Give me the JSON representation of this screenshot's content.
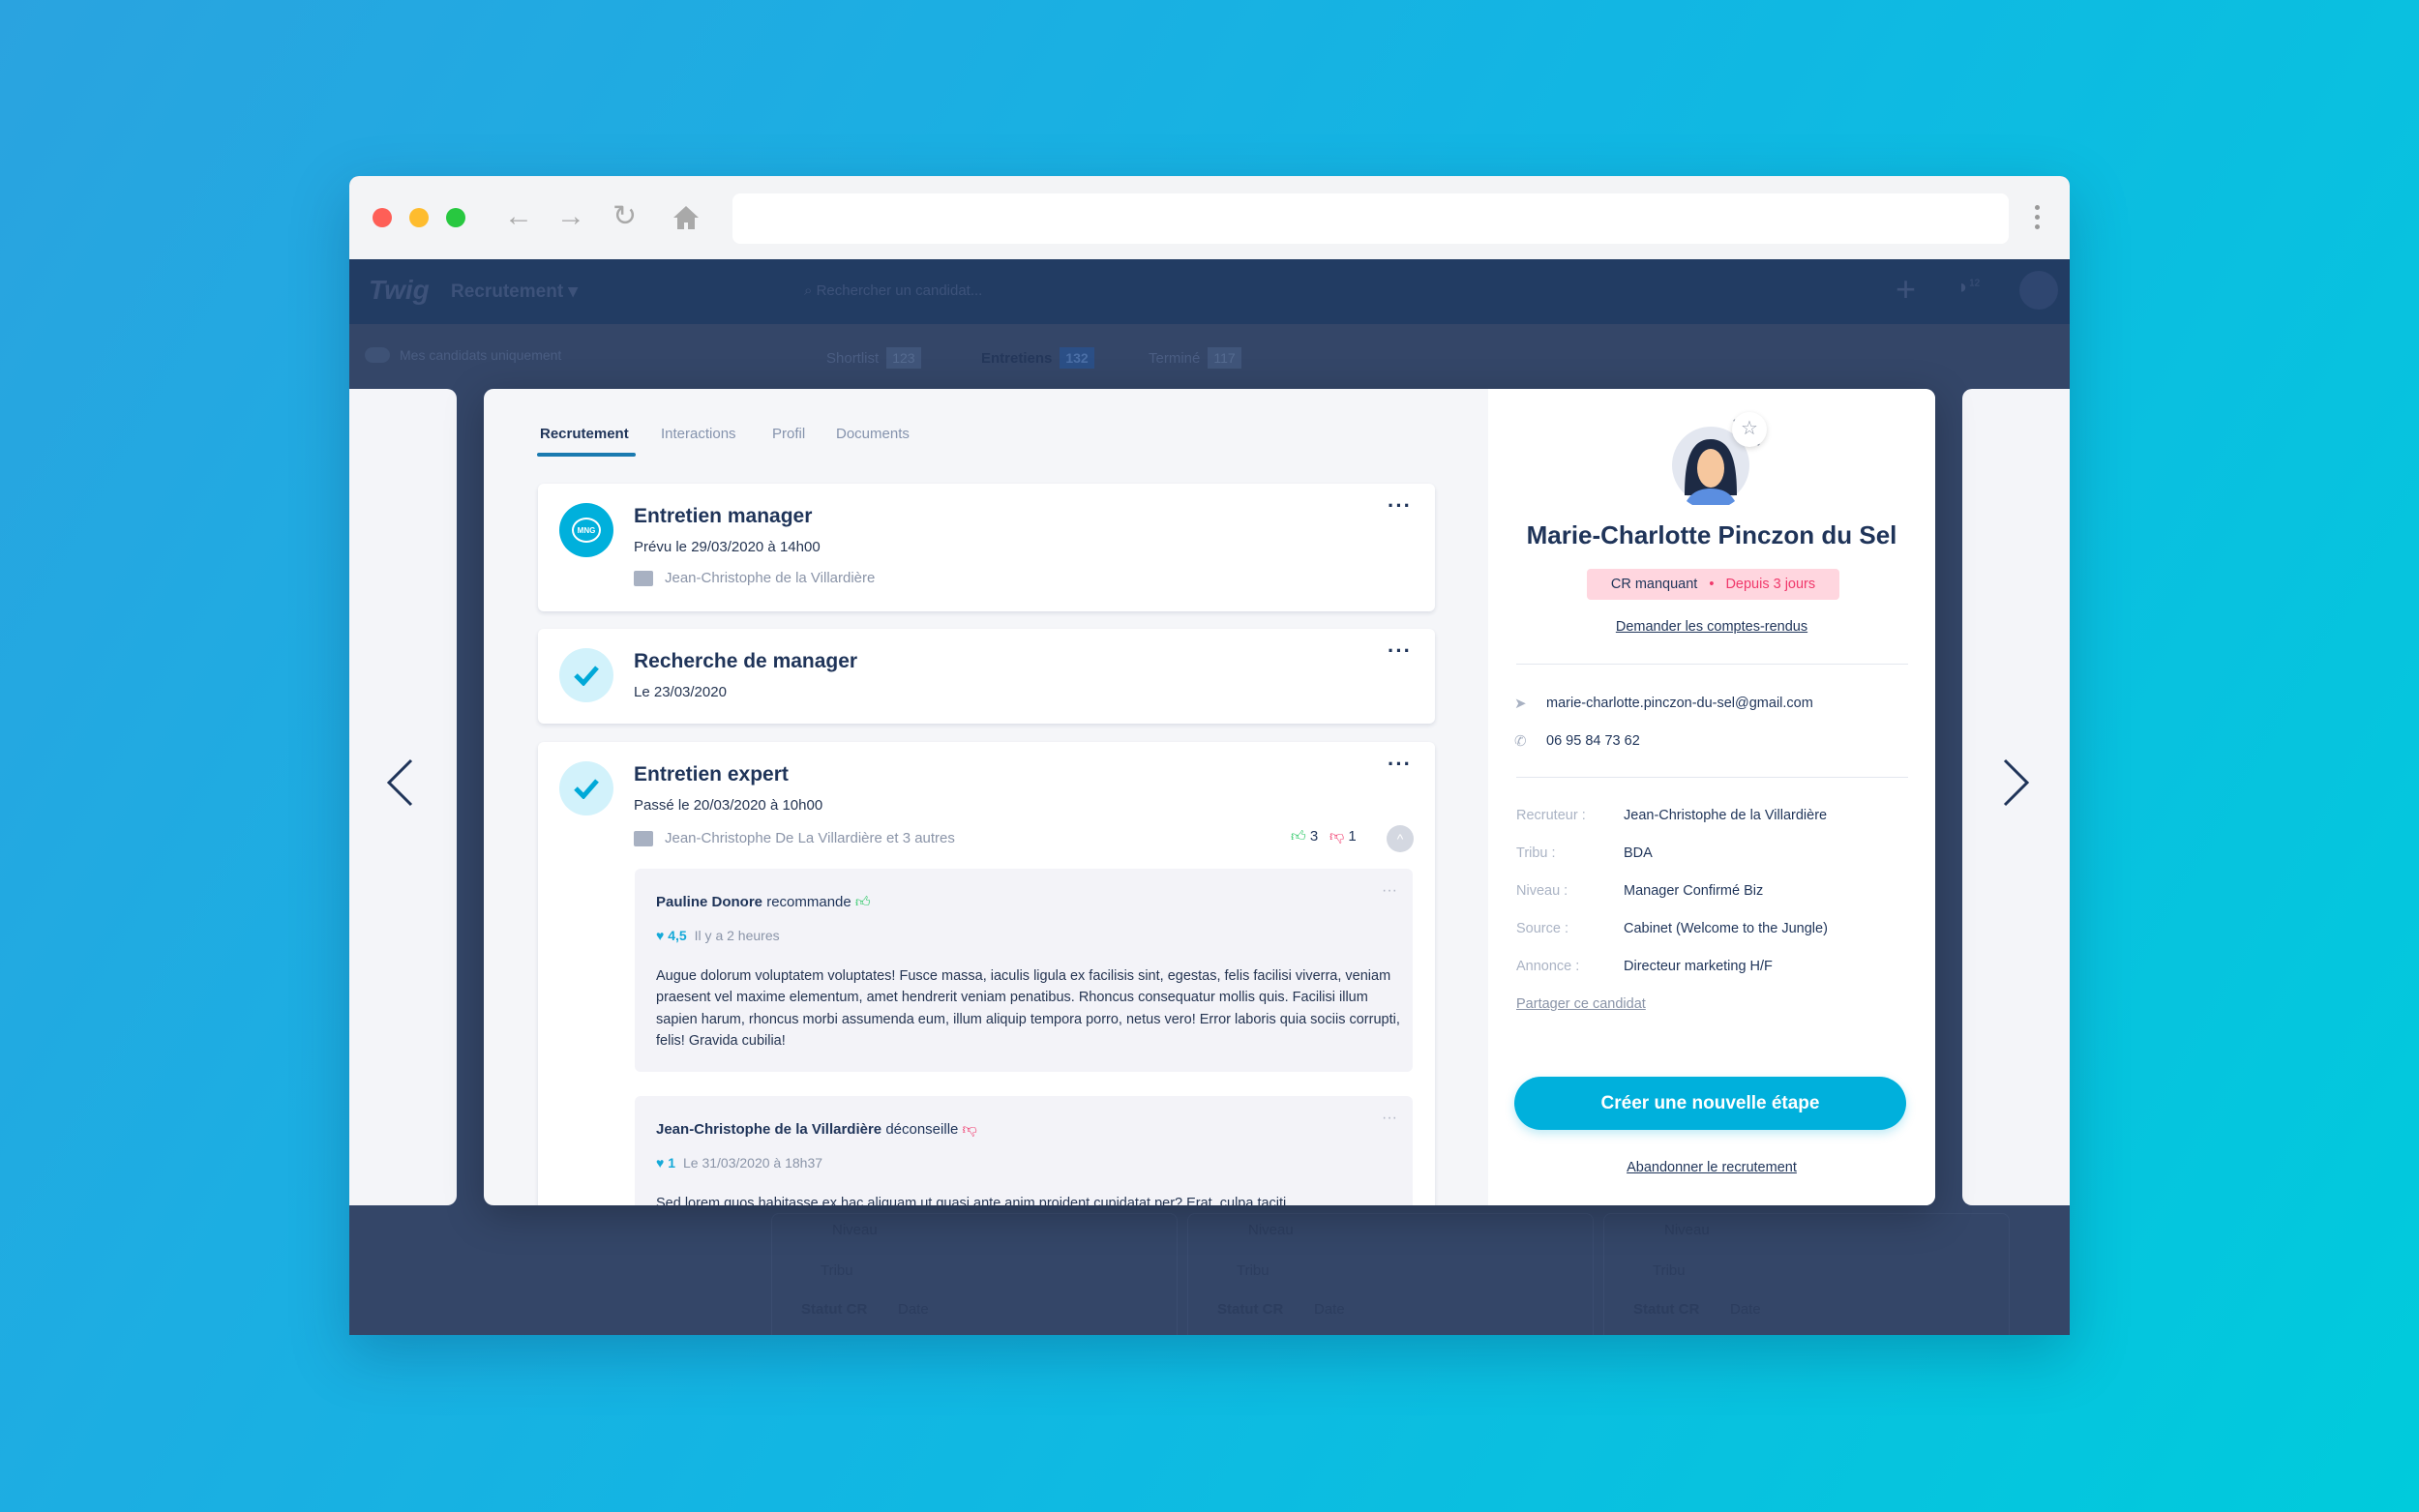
{
  "browser": {
    "traffic_lights": [
      "#fe5f57",
      "#febc2e",
      "#28c840"
    ],
    "icons": [
      "arrow-left",
      "arrow-right",
      "reload",
      "home",
      "kebab"
    ]
  },
  "app": {
    "logo": "Twig",
    "section": "Recrutement",
    "search_placeholder": "Rechercher un candidat...",
    "notification_count": "12",
    "toggle_label": "Mes candidats uniquement",
    "pipeline_tabs": [
      {
        "label": "Shortlist",
        "count": "123"
      },
      {
        "label": "Entretiens",
        "count": "132"
      },
      {
        "label": "Terminé",
        "count": "117"
      }
    ]
  },
  "background_cards": [
    {
      "niveau": "Niveau",
      "tribu": "Tribu",
      "statut": "Statut CR",
      "date": "Date"
    },
    {
      "niveau": "Niveau",
      "tribu": "Tribu",
      "statut": "Statut CR",
      "date": "Date"
    },
    {
      "niveau": "Niveau",
      "tribu": "Tribu",
      "statut": "Statut CR",
      "date": "Date"
    }
  ],
  "modal": {
    "tabs": [
      "Recrutement",
      "Interactions",
      "Profil",
      "Documents"
    ],
    "active_tab": "Recrutement",
    "steps": [
      {
        "title": "Entretien manager",
        "date": "Prévu le 29/03/2020 à 14h00",
        "recruiter": "Jean-Christophe de la Villardière",
        "icon_text": "MNG",
        "status": "scheduled"
      },
      {
        "title": "Recherche de manager",
        "date": "Le 23/03/2020",
        "status": "done"
      },
      {
        "title": "Entretien expert",
        "date": "Passé le 20/03/2020 à 10h00",
        "recruiter": "Jean-Christophe De La Villardière et 3 autres",
        "status": "done",
        "thumbs_up": "3",
        "thumbs_down": "1",
        "feedbacks": [
          {
            "author": "Pauline Donore",
            "verdict": "recommande",
            "verdict_type": "positive",
            "rating": "4,5",
            "time": "Il y a 2 heures",
            "text": "Augue dolorum voluptatem voluptates! Fusce massa, iaculis ligula ex facilisis sint, egestas, felis facilisi viverra, veniam praesent vel maxime elementum, amet hendrerit veniam penatibus. Rhoncus consequatur mollis quis. Facilisi illum sapien harum, rhoncus morbi assumenda eum, illum aliquip tempora porro, netus vero! Error laboris quia sociis corrupti, felis! Gravida cubilia!"
          },
          {
            "author": "Jean-Christophe de la Villardière",
            "verdict": "déconseille",
            "verdict_type": "negative",
            "rating": "1",
            "time": "Le 31/03/2020 à 18h37",
            "text": "Sed lorem quos habitasse ex hac aliquam ut quasi ante anim proident cupidatat per? Erat, culpa taciti"
          }
        ]
      }
    ]
  },
  "candidate": {
    "name": "Marie-Charlotte Pinczon du Sel",
    "badge_status": "CR manquant",
    "badge_since": "Depuis 3 jours",
    "request_link": "Demander les comptes-rendus",
    "email": "marie-charlotte.pinczon-du-sel@gmail.com",
    "phone": "06 95 84 73 62",
    "info": [
      {
        "label": "Recruteur :",
        "value": "Jean-Christophe de la Villardière"
      },
      {
        "label": "Tribu :",
        "value": "BDA"
      },
      {
        "label": "Niveau :",
        "value": "Manager Confirmé Biz"
      },
      {
        "label": "Source :",
        "value": "Cabinet (Welcome to the Jungle)"
      },
      {
        "label": "Annonce :",
        "value": "Directeur marketing H/F"
      }
    ],
    "share_link": "Partager ce candidat",
    "primary_button": "Créer une nouvelle étape",
    "abandon_link": "Abandonner le recrutement"
  },
  "colors": {
    "accent": "#00b0dc",
    "navy": "#1f3459",
    "positive": "#22c55e",
    "negative": "#f0386b",
    "badge_bg": "#ffd6df"
  }
}
